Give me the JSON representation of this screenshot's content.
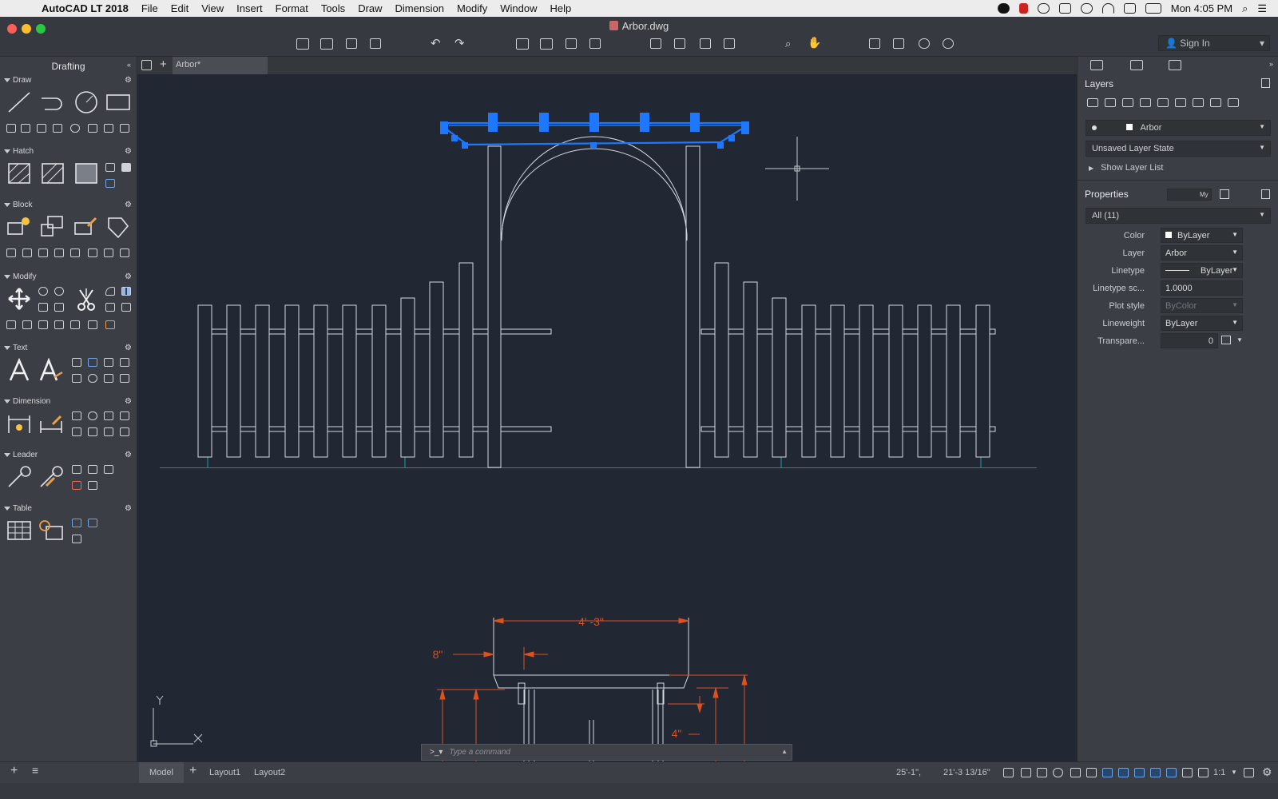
{
  "menubar": {
    "app": "AutoCAD LT 2018",
    "items": [
      "File",
      "Edit",
      "View",
      "Insert",
      "Format",
      "Tools",
      "Draw",
      "Dimension",
      "Modify",
      "Window",
      "Help"
    ],
    "clock": "Mon 4:05 PM"
  },
  "window": {
    "title": "Arbor.dwg",
    "sign_in": "Sign In"
  },
  "palette": {
    "title": "Drafting",
    "sections": [
      "Draw",
      "Hatch",
      "Block",
      "Modify",
      "Text",
      "Dimension",
      "Leader",
      "Table"
    ]
  },
  "tabs": {
    "drawing_tab": "Arbor*"
  },
  "command_line": {
    "prompt": ">_▾",
    "placeholder": "Type a command"
  },
  "dimensions": {
    "overall_width": "4' -3\"",
    "left_offset": "8\"",
    "post_height": "4\""
  },
  "layers_panel": {
    "title": "Layers",
    "current_layer": "Arbor",
    "layer_state": "Unsaved Layer State",
    "show_layer_list": "Show Layer List"
  },
  "properties_panel": {
    "title": "Properties",
    "toggle_label": "My",
    "filter": "All (11)",
    "rows": [
      {
        "label": "Color",
        "value": "ByLayer"
      },
      {
        "label": "Layer",
        "value": "Arbor"
      },
      {
        "label": "Linetype",
        "value": "ByLayer"
      },
      {
        "label": "Linetype sc...",
        "value": "1.0000"
      },
      {
        "label": "Plot style",
        "value": "ByColor"
      },
      {
        "label": "Lineweight",
        "value": "ByLayer"
      },
      {
        "label": "Transpare...",
        "value": "0"
      }
    ]
  },
  "statusbar": {
    "model": "Model",
    "layout1": "Layout1",
    "layout2": "Layout2",
    "coord_x": "25'-1\",",
    "coord_y": "21'-3 13/16\"",
    "scale": "1:1"
  },
  "colors": {
    "canvas_bg": "#212733",
    "selection_blue": "#1e78ff",
    "dimension_orange": "#e0501e",
    "panel_bg": "#3b3e44"
  }
}
